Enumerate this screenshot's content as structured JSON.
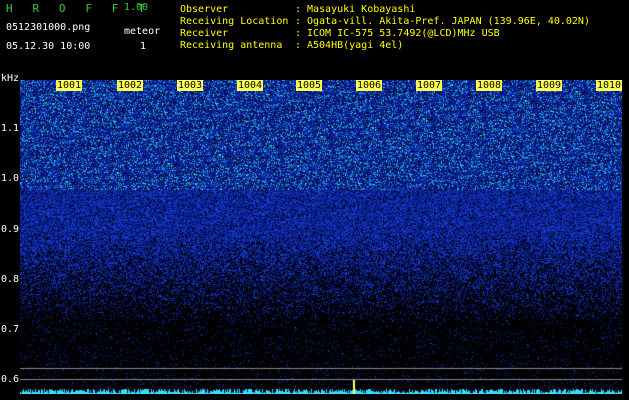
{
  "header": {
    "title": "H R O F F T",
    "version": "1.00",
    "filename": "0512301000.png",
    "meteor_label": "meteor",
    "datetime": "05.12.30 10:00",
    "meteor_count": "1"
  },
  "info": [
    {
      "label": "Observer",
      "sep": ":",
      "value": "Masayuki Kobayashi"
    },
    {
      "label": "Receiving Location",
      "sep": ":",
      "value": "Ogata-vill. Akita-Pref. JAPAN (139.96E, 40.02N)"
    },
    {
      "label": "Receiver",
      "sep": ":",
      "value": "ICOM IC-575 53.7492(@LCD)MHz USB"
    },
    {
      "label": "Receiving antenna",
      "sep": ":",
      "value": "A504HB(yagi 4el)"
    }
  ],
  "axis": {
    "y_unit": "kHz",
    "y_ticks": [
      "1.1",
      "1.0",
      "0.9",
      "0.8",
      "0.7",
      "0.6"
    ],
    "x_ticks": [
      "1001",
      "1002",
      "1003",
      "1004",
      "1005",
      "1006",
      "1007",
      "1008",
      "1009",
      "1010"
    ]
  },
  "colors": {
    "header_green": "#33cc33",
    "info_yellow": "#ffff00",
    "minute_label_bg": "#ffff55",
    "noise_cyan": "#33ddff",
    "signal_blue": "#1a3dcc"
  }
}
